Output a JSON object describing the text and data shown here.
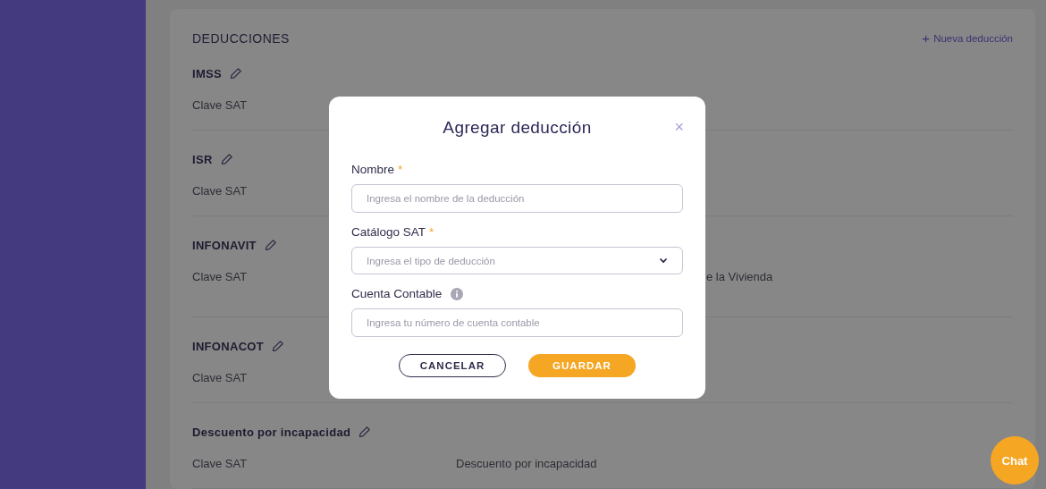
{
  "section": {
    "title": "DEDUCCIONES",
    "add_link": {
      "icon": "+",
      "label": "Nueva deducción"
    }
  },
  "deductions": [
    {
      "name": "IMSS",
      "field_label": "Clave SAT"
    },
    {
      "name": "ISR",
      "field_label": "Clave SAT"
    },
    {
      "name": "INFONAVIT",
      "field_label": "Clave SAT",
      "value": "e la Vivienda",
      "kind": "partly_hidden"
    },
    {
      "name": "INFONACOT",
      "field_label": "Clave SAT"
    },
    {
      "name": "Descuento por incapacidad",
      "field_label": "Clave SAT",
      "value": "Descuento por incapacidad",
      "kind": "plain"
    }
  ],
  "dialog": {
    "title": "Agregar deducción",
    "close": "×",
    "fields": [
      {
        "label": "Nombre",
        "marker": "*",
        "kind": "text",
        "placeholder": "Ingresa el nombre de la deducción"
      },
      {
        "label": "Catálogo SAT",
        "marker": "*",
        "kind": "select",
        "placeholder": "Ingresa el tipo de deducción"
      },
      {
        "label": "Cuenta Contable",
        "info": true,
        "kind": "text",
        "placeholder": "Ingresa tu número de cuenta contable"
      }
    ],
    "buttons": [
      {
        "label": "CANCELAR",
        "kind": "secondary"
      },
      {
        "label": "GUARDAR",
        "kind": "primary"
      }
    ]
  },
  "chat": {
    "label": "Chat"
  }
}
